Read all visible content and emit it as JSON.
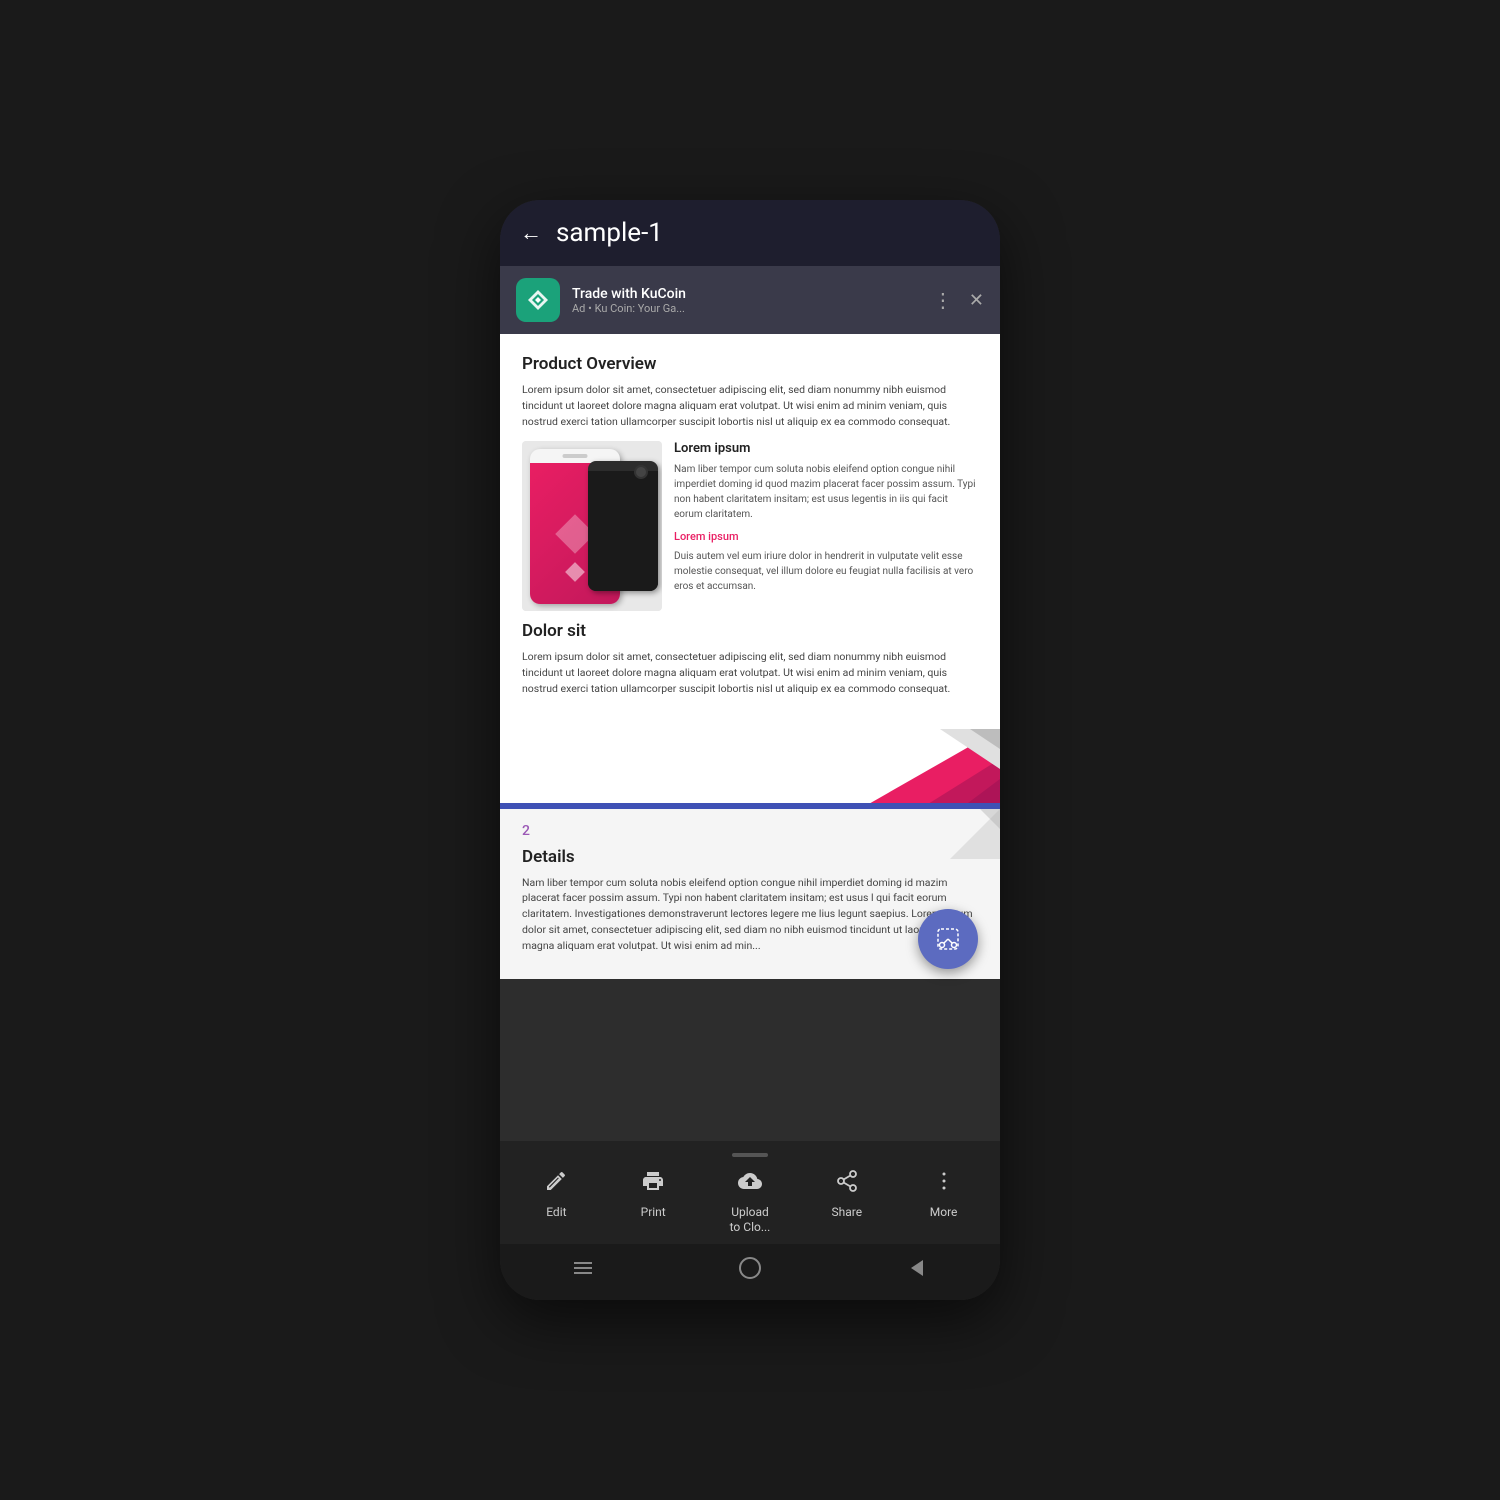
{
  "header": {
    "back_label": "←",
    "title": "sample-1"
  },
  "ad": {
    "app_name": "Trade with KuCoin",
    "label": "Ad",
    "subtitle": "Ku Coin: Your Ga...",
    "more_icon": "⋮",
    "close_icon": "✕"
  },
  "page1": {
    "section_title": "Product Overview",
    "body_text": "Lorem ipsum dolor sit amet, consectetuer adipiscing elit, sed diam nonummy nibh euismod tincidunt ut laoreet dolore magna aliquam erat volutpat. Ut wisi enim ad minim veniam, quis nostrud exerci tation ullamcorper suscipit lobortis nisl ut aliquip ex ea commodo consequat.",
    "lorem_title": "Lorem ipsum",
    "lorem_body": "Nam liber tempor cum soluta nobis eleifend option congue nihil imperdiet doming id quod mazim placerat facer possim assum. Typi non habent claritatem insitam; est usus legentis in iis qui facit eorum claritatem.",
    "lorem_link": "Lorem ipsum",
    "lorem_body2": "Duis autem vel eum iriure dolor in hendrerit in vulputate velit esse molestie consequat, vel illum dolore eu feugiat nulla facilisis at vero eros et accumsan.",
    "dolor_title": "Dolor sit",
    "dolor_body": "Lorem ipsum dolor sit amet, consectetuer adipiscing elit, sed diam nonummy nibh euismod tincidunt ut laoreet dolore magna aliquam erat volutpat. Ut wisi enim ad minim veniam, quis nostrud exerci tation ullamcorper suscipit lobortis nisl ut aliquip ex ea commodo consequat."
  },
  "page2": {
    "number": "2",
    "details_title": "Details",
    "details_text": "Nam liber tempor cum soluta nobis eleifend option congue nihil imperdiet doming id mazim placerat facer possim assum. Typi non habent claritatem insitam; est usus l qui facit eorum claritatem. Investigationes demonstraverunt lectores legere me lius legunt saepius. Lorem ipsum dolor sit amet, consectetuer adipiscing elit, sed diam no nibh euismod tincidunt ut laoreet dolore magna aliquam erat volutpat. Ut wisi enim ad min..."
  },
  "toolbar": {
    "edit_label": "Edit",
    "print_label": "Print",
    "upload_label": "Upload\nto Clo...",
    "share_label": "Share",
    "more_label": "More"
  },
  "colors": {
    "brand_pink": "#e91e63",
    "brand_blue": "#3f51b5",
    "brand_purple": "#9b59b6",
    "fab_color": "#5c6bc0",
    "top_bar": "#1e1e2e",
    "ad_bar": "#3a3a4a"
  }
}
